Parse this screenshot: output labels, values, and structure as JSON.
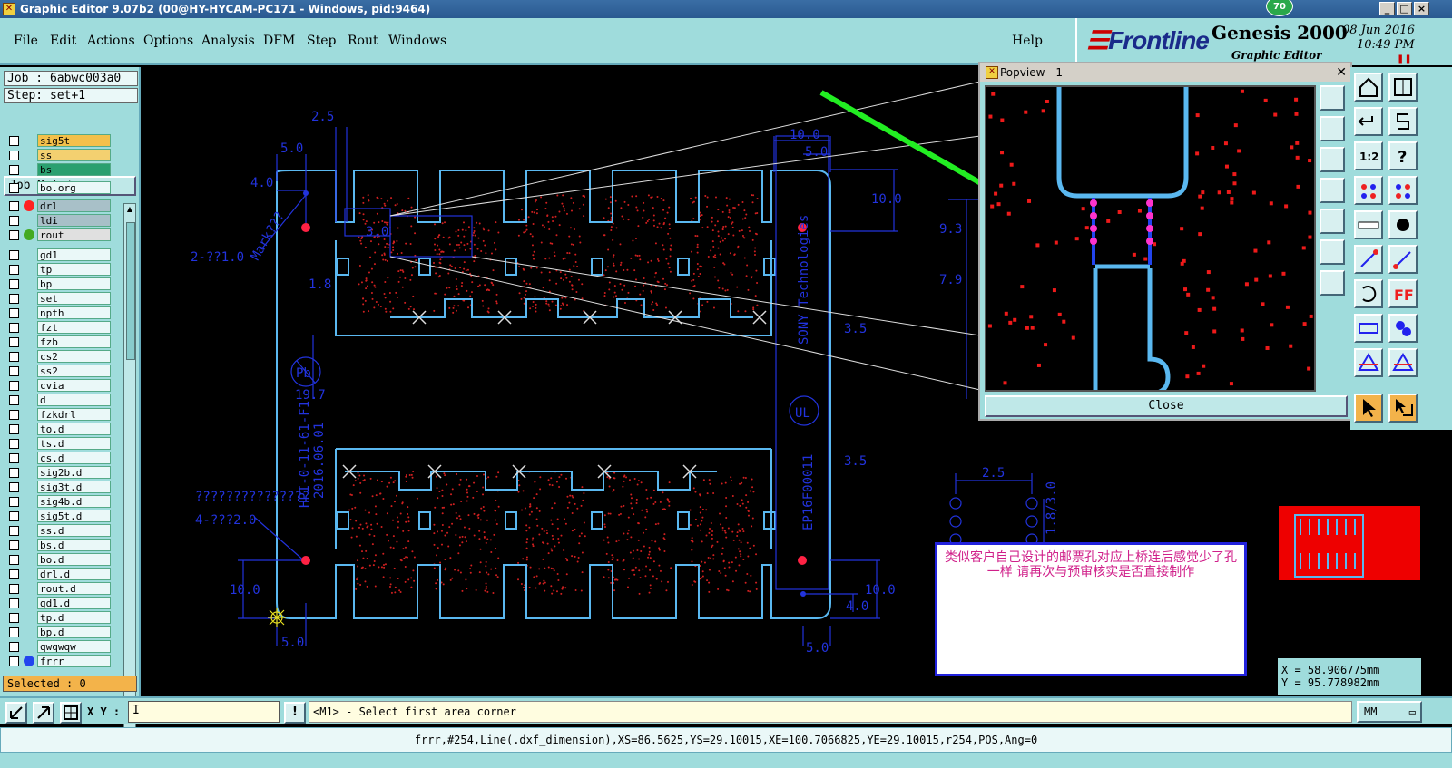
{
  "window": {
    "title": "Graphic Editor 9.07b2 (00@HY-HYCAM-PC171 - Windows, pid:9464)",
    "badge": "70",
    "minimize": "_",
    "maximize": "□",
    "close": "×"
  },
  "menu": {
    "items": [
      "File",
      "Edit",
      "Actions",
      "Options",
      "Analysis",
      "DFM",
      "Step",
      "Rout",
      "Windows"
    ],
    "help": "Help"
  },
  "brand": {
    "logo": "Frontline",
    "product": "Genesis 2000",
    "subtitle": "Graphic Editor",
    "date": "08 Jun 2016",
    "time": "10:49 PM"
  },
  "left_panel": {
    "job": "Job : 6abwc003a0",
    "step": "Step: set+1",
    "job_matrix": "Job Matrix ...",
    "layers": [
      {
        "name": "sig5t",
        "bg": "#f3c04a"
      },
      {
        "name": "ss",
        "bg": "#f3d070"
      },
      {
        "name": "bs",
        "bg": "#2aa070"
      },
      {
        "name": "bo.org",
        "bg": "#eaf8f8"
      },
      {
        "name": "drl",
        "bg": "#a8c0c8",
        "dot": "#ff2222"
      },
      {
        "name": "ldi",
        "bg": "#a8c0c8"
      },
      {
        "name": "rout",
        "bg": "#e0e0e0",
        "dot": "#44aa22"
      },
      {
        "name": "gd1",
        "bg": "#eaf8f8"
      },
      {
        "name": "tp",
        "bg": "#eaf8f8"
      },
      {
        "name": "bp",
        "bg": "#eaf8f8"
      },
      {
        "name": "set",
        "bg": "#eaf8f8"
      },
      {
        "name": "npth",
        "bg": "#eaf8f8"
      },
      {
        "name": "fzt",
        "bg": "#eaf8f8"
      },
      {
        "name": "fzb",
        "bg": "#eaf8f8"
      },
      {
        "name": "cs2",
        "bg": "#eaf8f8"
      },
      {
        "name": "ss2",
        "bg": "#eaf8f8"
      },
      {
        "name": "cvia",
        "bg": "#eaf8f8"
      },
      {
        "name": "d",
        "bg": "#eaf8f8"
      },
      {
        "name": "fzkdrl",
        "bg": "#eaf8f8"
      },
      {
        "name": "to.d",
        "bg": "#eaf8f8"
      },
      {
        "name": "ts.d",
        "bg": "#eaf8f8"
      },
      {
        "name": "cs.d",
        "bg": "#eaf8f8"
      },
      {
        "name": "sig2b.d",
        "bg": "#eaf8f8"
      },
      {
        "name": "sig3t.d",
        "bg": "#eaf8f8"
      },
      {
        "name": "sig4b.d",
        "bg": "#eaf8f8"
      },
      {
        "name": "sig5t.d",
        "bg": "#eaf8f8"
      },
      {
        "name": "ss.d",
        "bg": "#eaf8f8"
      },
      {
        "name": "bs.d",
        "bg": "#eaf8f8"
      },
      {
        "name": "bo.d",
        "bg": "#eaf8f8"
      },
      {
        "name": "drl.d",
        "bg": "#eaf8f8"
      },
      {
        "name": "rout.d",
        "bg": "#eaf8f8"
      },
      {
        "name": "gd1.d",
        "bg": "#eaf8f8"
      },
      {
        "name": "tp.d",
        "bg": "#eaf8f8"
      },
      {
        "name": "bp.d",
        "bg": "#eaf8f8"
      },
      {
        "name": "qwqwqw",
        "bg": "#eaf8f8"
      },
      {
        "name": "frrr",
        "bg": "#eaf8f8",
        "dot": "#2244ee"
      }
    ],
    "selected": "Selected : 0"
  },
  "canvas": {
    "dims": [
      "2.5",
      "5.0",
      "4.0",
      "10.0",
      "5.0",
      "10.0",
      "9.3",
      "7.9",
      "2-??1.0",
      "Mark???",
      "3.0",
      "1.8",
      "3.5",
      "19.7",
      "3.5",
      "4-???2.0",
      "???????????????",
      "10.0",
      "5.0",
      "10.0",
      "4.0",
      "5.0",
      "2.5",
      "1.8/3.0"
    ],
    "vtext1": "SONY Technologies",
    "vtext2": "HPI-0-11-61-F1",
    "vtext3": "2016.06.01",
    "vtext4": "EP16F00011",
    "ul": "UL",
    "pb": "Pb"
  },
  "popview": {
    "title": "Popview - 1",
    "close": "Close"
  },
  "note": {
    "text": "类似客户自己设计的邮票孔对应上桥连后感觉少了孔一样   请再次与预审核实是否直接制作"
  },
  "coords": {
    "x": "X = 58.906775mm",
    "y": "Y = 95.778982mm"
  },
  "cmdbar": {
    "xy_label": "X Y :",
    "xy_value": "I",
    "warn": "!",
    "prompt": "<M1> - Select first area corner",
    "units": "MM"
  },
  "statusbar": {
    "text": "frrr,#254,Line(.dxf_dimension),XS=86.5625,YS=29.10015,XE=100.7066825,YE=29.10015,r254,POS,Ang=0"
  },
  "colors": {
    "panel": "#9fdcdc",
    "outline": "#5ab8f0",
    "dimension": "#2233dd",
    "pad": "#ff2222",
    "arrow": "#22ee22",
    "note_text": "#d0208a"
  }
}
